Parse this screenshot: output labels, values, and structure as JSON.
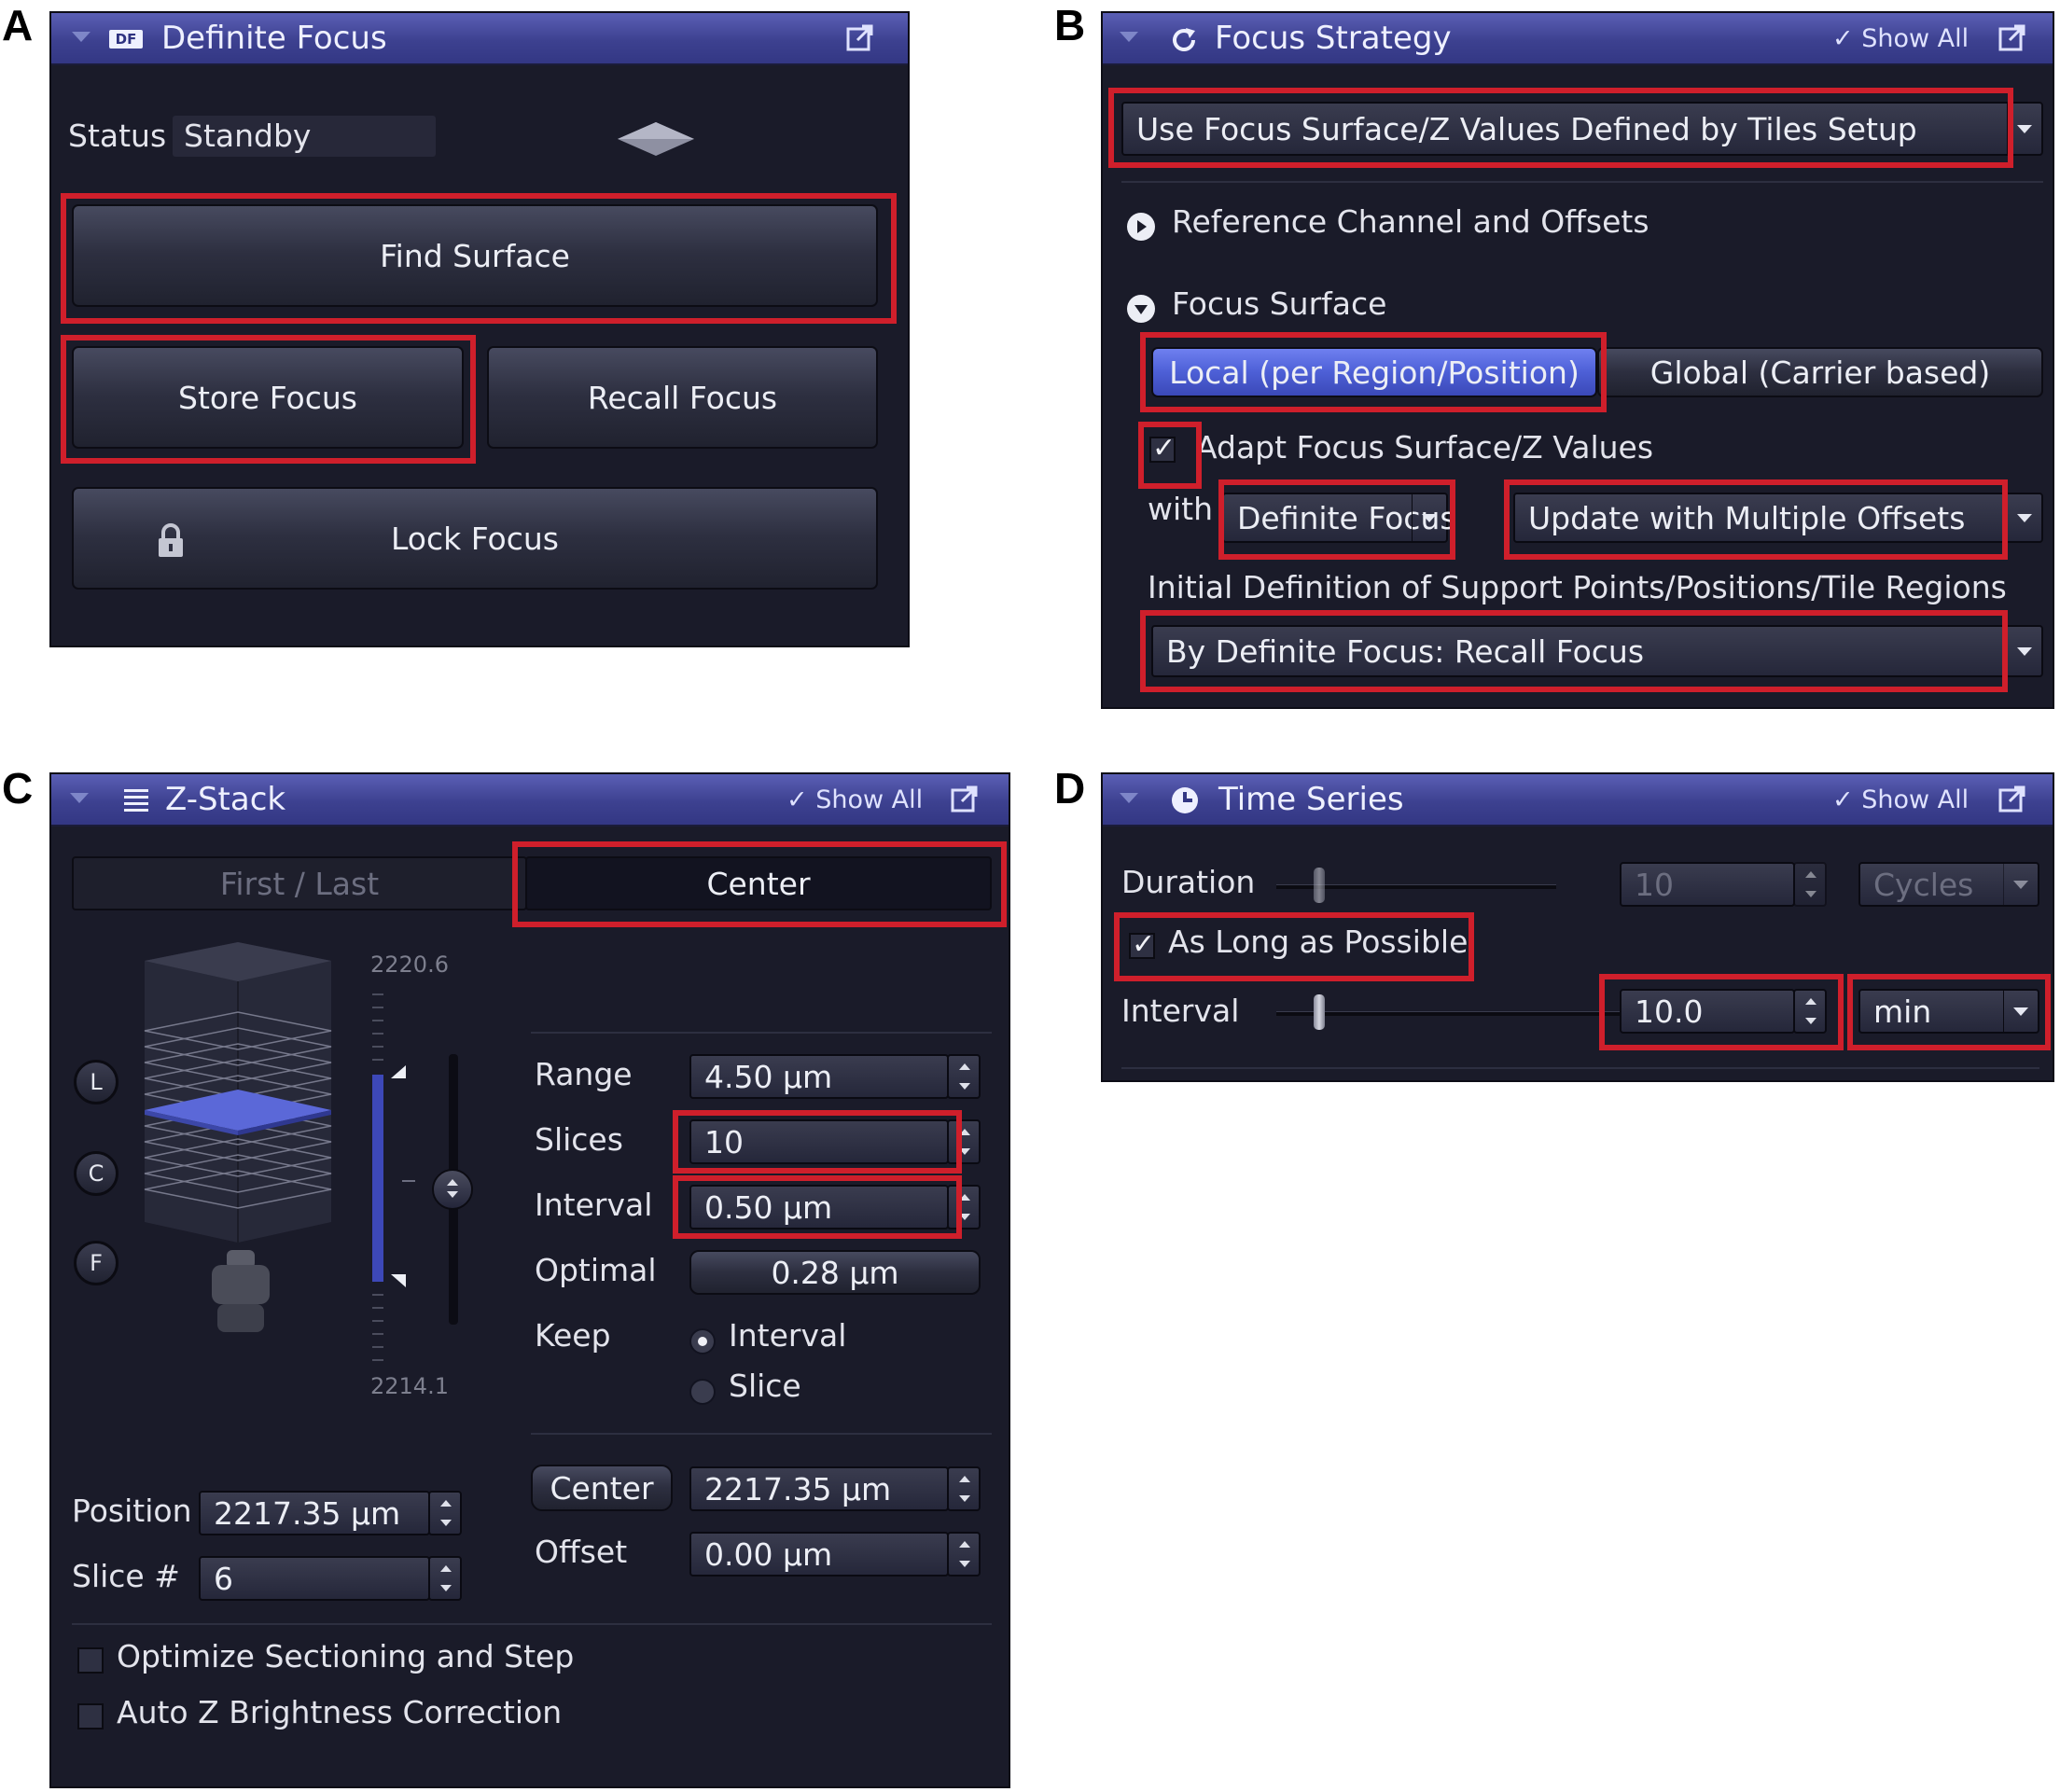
{
  "panel_labels": {
    "a": "A",
    "b": "B",
    "c": "C",
    "d": "D"
  },
  "colors": {
    "header": "#3d4190",
    "panel_bg": "#1a1b29",
    "highlight": "#cf1f2b",
    "active_blue": "#4d5fd6"
  },
  "panel_a": {
    "title": "Definite Focus",
    "badge": "DF",
    "status_label": "Status",
    "status_value": "Standby",
    "find_surface": "Find Surface",
    "store_focus": "Store Focus",
    "recall_focus": "Recall Focus",
    "lock_focus": "Lock Focus",
    "icons": [
      "df-icon",
      "popout-icon",
      "diamond-icon",
      "lock-icon"
    ]
  },
  "panel_b": {
    "title": "Focus Strategy",
    "show_all": "✓ Show All",
    "strategy_value": "Use Focus Surface/Z Values Defined by Tiles Setup",
    "reference_section": "Reference Channel and Offsets",
    "focus_surface_section": "Focus Surface",
    "local_button": "Local (per Region/Position)",
    "global_button": "Global (Carrier based)",
    "adapt_label": "Adapt Focus Surface/Z Values",
    "adapt_checked": true,
    "with_label": "with",
    "with_value": "Definite Focus",
    "update_value": "Update with Multiple Offsets",
    "initial_label": "Initial Definition of Support Points/Positions/Tile Regions",
    "initial_value": "By Definite Focus: Recall Focus"
  },
  "panel_c": {
    "title": "Z-Stack",
    "show_all": "✓ Show All",
    "tab_first_last": "First / Last",
    "tab_center": "Center",
    "top_value": "2220.6",
    "bottom_value": "2214.1",
    "markers": {
      "l": "L",
      "c": "C",
      "f": "F"
    },
    "range_label": "Range",
    "range_value": "4.50 µm",
    "slices_label": "Slices",
    "slices_value": "10",
    "interval_label": "Interval",
    "interval_value": "0.50 µm",
    "optimal_label": "Optimal",
    "optimal_value": "0.28 µm",
    "keep_label": "Keep",
    "keep_interval": "Interval",
    "keep_slice": "Slice",
    "center_button": "Center",
    "center_value": "2217.35 µm",
    "offset_label": "Offset",
    "offset_value": "0.00 µm",
    "position_label": "Position",
    "position_value": "2217.35 µm",
    "slice_label": "Slice #",
    "slice_value": "6",
    "optimize_label": "Optimize Sectioning and Step",
    "autoz_label": "Auto Z Brightness Correction"
  },
  "panel_d": {
    "title": "Time Series",
    "show_all": "✓ Show All",
    "duration_label": "Duration",
    "duration_value": "10",
    "duration_unit": "Cycles",
    "as_long_label": "As Long as Possible",
    "as_long_checked": true,
    "interval_label": "Interval",
    "interval_value": "10.0",
    "interval_unit": "min"
  }
}
